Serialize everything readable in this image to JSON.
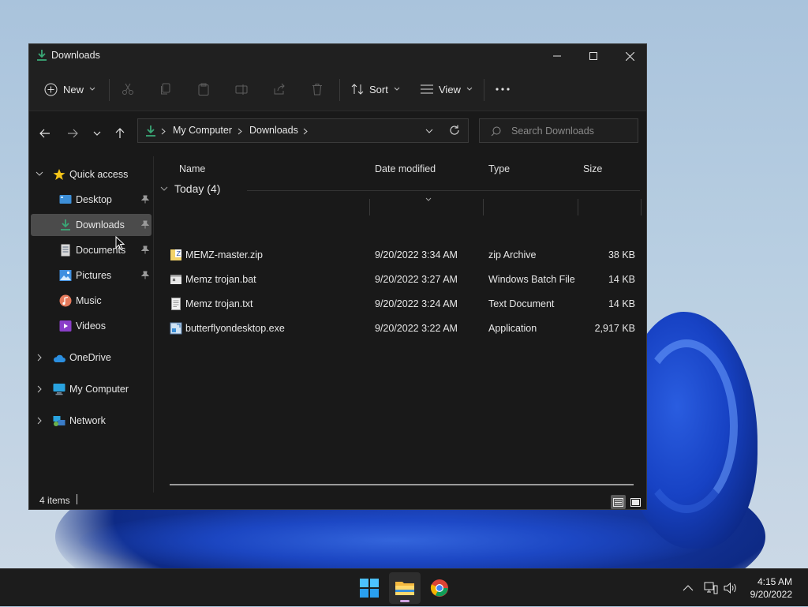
{
  "window": {
    "title": "Downloads",
    "controls": {
      "minimize": "minimize-icon",
      "maximize": "maximize-icon",
      "close": "close-icon"
    }
  },
  "toolbar": {
    "new_label": "New",
    "sort_label": "Sort",
    "view_label": "View",
    "icons": [
      "cut-icon",
      "copy-icon",
      "paste-icon",
      "rename-icon",
      "share-icon",
      "delete-icon",
      "more-icon"
    ]
  },
  "address": {
    "crumbs": [
      "My Computer",
      "Downloads"
    ],
    "search_placeholder": "Search Downloads"
  },
  "sidebar": {
    "quick_access": "Quick access",
    "items": [
      {
        "label": "Desktop",
        "pinned": true
      },
      {
        "label": "Downloads",
        "pinned": true
      },
      {
        "label": "Documents",
        "pinned": true
      },
      {
        "label": "Pictures",
        "pinned": true
      },
      {
        "label": "Music",
        "pinned": false
      },
      {
        "label": "Videos",
        "pinned": false
      }
    ],
    "roots": [
      {
        "label": "OneDrive"
      },
      {
        "label": "My Computer"
      },
      {
        "label": "Network"
      }
    ]
  },
  "columns": {
    "name": "Name",
    "date": "Date modified",
    "type": "Type",
    "size": "Size"
  },
  "group": {
    "label": "Today (4)"
  },
  "files": [
    {
      "name": "MEMZ-master.zip",
      "date": "9/20/2022 3:34 AM",
      "type": "zip Archive",
      "size": "38 KB",
      "icon": "zip-file-icon"
    },
    {
      "name": "Memz trojan.bat",
      "date": "9/20/2022 3:27 AM",
      "type": "Windows Batch File",
      "size": "14 KB",
      "icon": "batch-file-icon"
    },
    {
      "name": "Memz trojan.txt",
      "date": "9/20/2022 3:24 AM",
      "type": "Text Document",
      "size": "14 KB",
      "icon": "text-file-icon"
    },
    {
      "name": "butterflyondesktop.exe",
      "date": "9/20/2022 3:22 AM",
      "type": "Application",
      "size": "2,917 KB",
      "icon": "application-icon"
    }
  ],
  "status": {
    "item_count": "4 items"
  },
  "taskbar": {
    "apps": [
      "start-icon",
      "file-explorer-icon",
      "chrome-icon"
    ],
    "time": "4:15 AM",
    "date": "9/20/2022"
  },
  "colors": {
    "accent_green": "#3aa776",
    "selection_bg": "#4b4b4b",
    "window_bg": "#191919"
  }
}
